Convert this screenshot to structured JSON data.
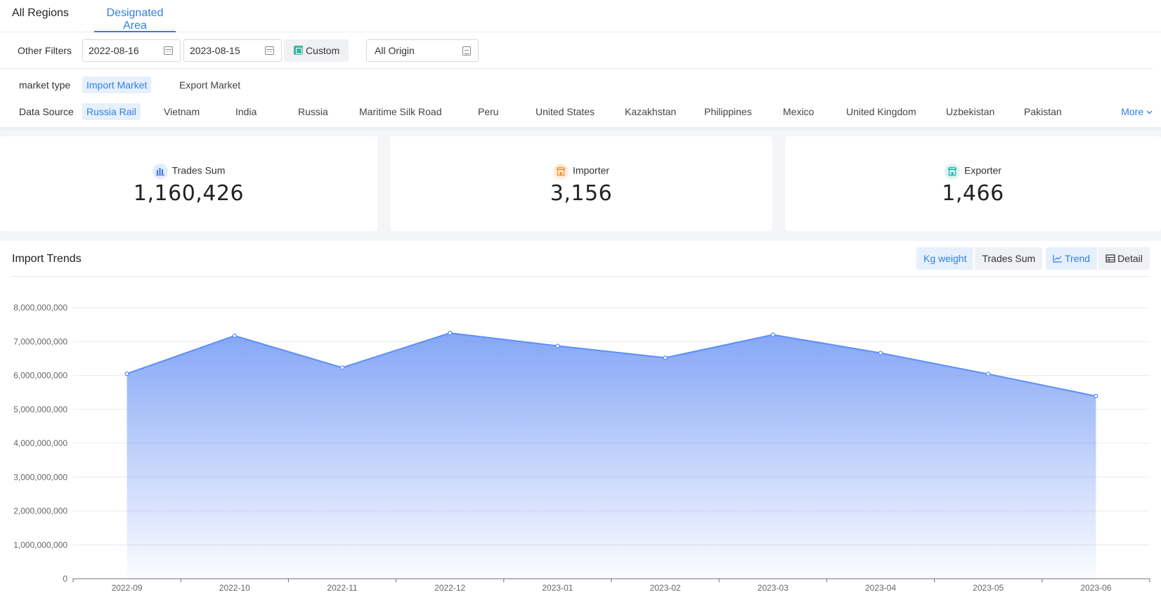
{
  "tabs": [
    {
      "label": "All Regions"
    },
    {
      "label": "Designated Area"
    }
  ],
  "filters": {
    "label": "Other Filters",
    "start_date": "2022-08-16",
    "end_date": "2023-08-15",
    "custom_label": "Custom",
    "origin": "All Origin"
  },
  "market_type": {
    "label": "market type",
    "options": [
      "Import Market",
      "Export Market"
    ],
    "selected": "Import Market"
  },
  "data_source": {
    "label": "Data Source",
    "options": [
      "Russia Rail",
      "Vietnam",
      "India",
      "Russia",
      "Maritime Silk Road",
      "Peru",
      "United States",
      "Kazakhstan",
      "Philippines",
      "Mexico",
      "United Kingdom",
      "Uzbekistan",
      "Pakistan"
    ],
    "selected": "Russia Rail",
    "more_label": "More"
  },
  "stats": [
    {
      "label": "Trades Sum",
      "value": "1,160,426",
      "icon": "bar-chart-icon"
    },
    {
      "label": "Importer",
      "value": "3,156",
      "icon": "store-icon"
    },
    {
      "label": "Exporter",
      "value": "1,466",
      "icon": "store-icon"
    }
  ],
  "trend": {
    "title": "Import Trends",
    "metric_toggle": [
      "Kg weight",
      "Trades Sum"
    ],
    "metric_selected": "Kg weight",
    "view_toggle": [
      "Trend",
      "Detail"
    ],
    "view_selected": "Trend"
  },
  "colors": {
    "accent": "#2f7ee6",
    "series_line": "#5b8ff9",
    "series_fill": "#8aabf7"
  },
  "chart_data": {
    "type": "area",
    "categories": [
      "2022-09",
      "2022-10",
      "2022-11",
      "2022-12",
      "2023-01",
      "2023-02",
      "2023-03",
      "2023-04",
      "2023-05",
      "2023-06"
    ],
    "values": [
      6050000000,
      7170000000,
      6230000000,
      7250000000,
      6870000000,
      6520000000,
      7200000000,
      6660000000,
      6040000000,
      5390000000
    ],
    "title": "",
    "xlabel": "",
    "ylabel": "",
    "ylim": [
      0,
      8000000000
    ],
    "yticks": [
      "0",
      "1,000,000,000",
      "2,000,000,000",
      "3,000,000,000",
      "4,000,000,000",
      "5,000,000,000",
      "6,000,000,000",
      "7,000,000,000",
      "8,000,000,000"
    ],
    "grid": true,
    "legend": "none"
  }
}
